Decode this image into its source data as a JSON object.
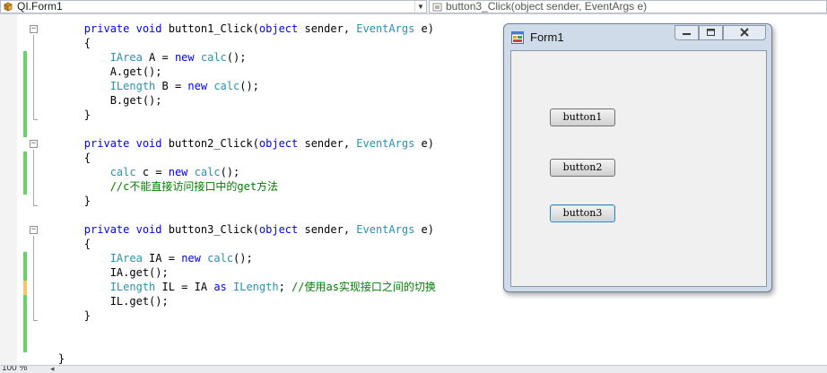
{
  "navigation": {
    "class_combo": "QI.Form1",
    "member_combo": "button3_Click(object sender, EventArgs e)"
  },
  "editor": {
    "lines": [
      [
        {
          "t": "        "
        },
        {
          "t": "private",
          "c": "kw"
        },
        {
          "t": " "
        },
        {
          "t": "void",
          "c": "kw"
        },
        {
          "t": " button1_Click("
        },
        {
          "t": "object",
          "c": "kw"
        },
        {
          "t": " sender, "
        },
        {
          "t": "EventArgs",
          "c": "ty"
        },
        {
          "t": " e)"
        }
      ],
      [
        {
          "t": "        {"
        }
      ],
      [
        {
          "t": "            "
        },
        {
          "t": "IArea",
          "c": "ty"
        },
        {
          "t": " A = "
        },
        {
          "t": "new",
          "c": "kw"
        },
        {
          "t": " "
        },
        {
          "t": "calc",
          "c": "ty"
        },
        {
          "t": "();"
        }
      ],
      [
        {
          "t": "            A.get();"
        }
      ],
      [
        {
          "t": "            "
        },
        {
          "t": "ILength",
          "c": "ty"
        },
        {
          "t": " B = "
        },
        {
          "t": "new",
          "c": "kw"
        },
        {
          "t": " "
        },
        {
          "t": "calc",
          "c": "ty"
        },
        {
          "t": "();"
        }
      ],
      [
        {
          "t": "            B.get();"
        }
      ],
      [
        {
          "t": "        }"
        }
      ],
      [],
      [
        {
          "t": "        "
        },
        {
          "t": "private",
          "c": "kw"
        },
        {
          "t": " "
        },
        {
          "t": "void",
          "c": "kw"
        },
        {
          "t": " button2_Click("
        },
        {
          "t": "object",
          "c": "kw"
        },
        {
          "t": " sender, "
        },
        {
          "t": "EventArgs",
          "c": "ty"
        },
        {
          "t": " e)"
        }
      ],
      [
        {
          "t": "        {"
        }
      ],
      [
        {
          "t": "            "
        },
        {
          "t": "calc",
          "c": "ty"
        },
        {
          "t": " c = "
        },
        {
          "t": "new",
          "c": "kw"
        },
        {
          "t": " "
        },
        {
          "t": "calc",
          "c": "ty"
        },
        {
          "t": "();"
        }
      ],
      [
        {
          "t": "            "
        },
        {
          "t": "//c不能直接访问接口中的get方法",
          "c": "cm"
        }
      ],
      [
        {
          "t": "        }"
        }
      ],
      [],
      [
        {
          "t": "        "
        },
        {
          "t": "private",
          "c": "kw"
        },
        {
          "t": " "
        },
        {
          "t": "void",
          "c": "kw"
        },
        {
          "t": " button3_Click("
        },
        {
          "t": "object",
          "c": "kw"
        },
        {
          "t": " sender, "
        },
        {
          "t": "EventArgs",
          "c": "ty"
        },
        {
          "t": " e)"
        }
      ],
      [
        {
          "t": "        {"
        }
      ],
      [
        {
          "t": "            "
        },
        {
          "t": "IArea",
          "c": "ty"
        },
        {
          "t": " IA = "
        },
        {
          "t": "new",
          "c": "kw"
        },
        {
          "t": " "
        },
        {
          "t": "calc",
          "c": "ty"
        },
        {
          "t": "();"
        }
      ],
      [
        {
          "t": "            IA.get();"
        }
      ],
      [
        {
          "t": "            "
        },
        {
          "t": "ILength",
          "c": "ty"
        },
        {
          "t": " IL = IA "
        },
        {
          "t": "as",
          "c": "kw"
        },
        {
          "t": " "
        },
        {
          "t": "ILength",
          "c": "ty"
        },
        {
          "t": "; "
        },
        {
          "t": "//使用as实现接口之间的切换",
          "c": "cm"
        }
      ],
      [
        {
          "t": "            IL.get();"
        }
      ],
      [
        {
          "t": "        }"
        }
      ],
      [],
      [],
      [
        {
          "t": "    }"
        }
      ]
    ]
  },
  "status": {
    "zoom": "100 %"
  },
  "form": {
    "title": "Form1",
    "buttons": [
      "button1",
      "button2",
      "button3"
    ]
  },
  "colors": {
    "keyword": "#0000ff",
    "type": "#2b91af",
    "comment": "#008000",
    "change_saved": "#6ccf6c",
    "change_unsaved": "#f1c869"
  }
}
